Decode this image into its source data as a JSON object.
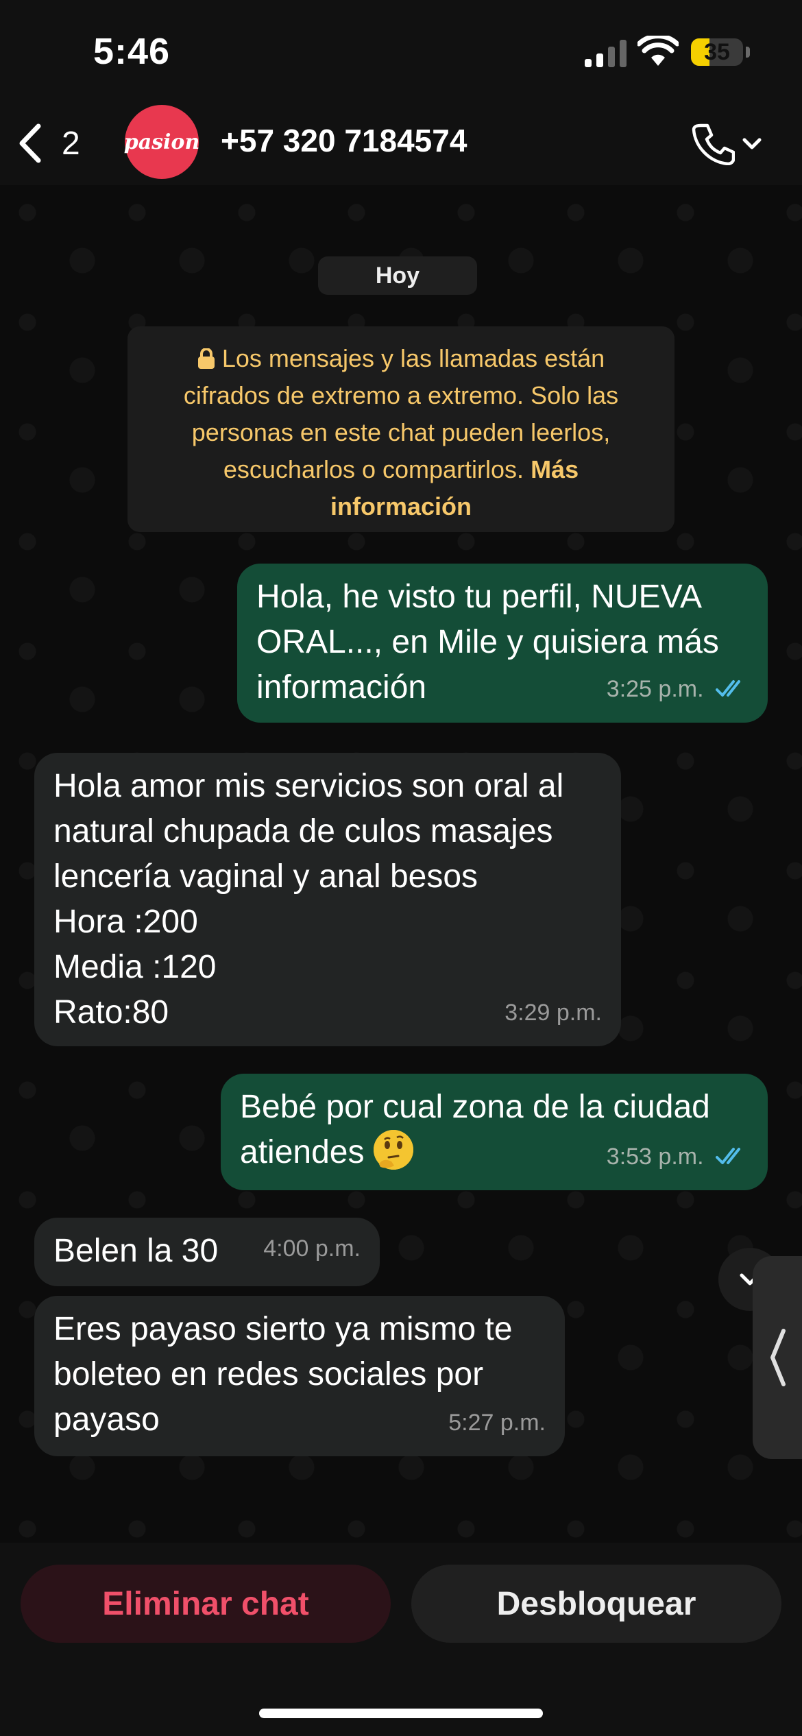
{
  "status": {
    "time": "5:46",
    "battery": "35",
    "battery_level": 0.35,
    "battery_color": "#f5d000"
  },
  "header": {
    "back_count": "2",
    "avatar_text": "pasion",
    "contact": "+57 320 7184574"
  },
  "chat": {
    "date_chip": "Hoy",
    "e2e_line1": "Los mensajes y las llamadas están",
    "e2e_line2": "cifrados de extremo a extremo. Solo las",
    "e2e_line3": "personas en este chat pueden leerlos,",
    "e2e_line4": "escucharlos o compartirlos.",
    "e2e_link1": "Más",
    "e2e_link2": "información",
    "messages": [
      {
        "dir": "out",
        "lines": [
          "Hola, he visto tu perfil, NUEVA",
          "ORAL..., en Mile y quisiera más",
          "información"
        ],
        "time": "3:25 p.m."
      },
      {
        "dir": "in",
        "lines": [
          "Hola amor mis servicios son oral al",
          "natural chupada de culos masajes",
          "lencería vaginal y anal besos",
          "Hora :200",
          "Media :120",
          "Rato:80"
        ],
        "time": "3:29 p.m."
      },
      {
        "dir": "out",
        "lines": [
          "Bebé por cual zona de la ciudad",
          "atiendes"
        ],
        "time": "3:53 p.m."
      },
      {
        "dir": "in",
        "lines": [
          "Belen la 30"
        ],
        "time": "4:00 p.m."
      },
      {
        "dir": "in",
        "lines": [
          "Eres payaso sierto ya mismo te",
          "boleteo en redes sociales por",
          "payaso"
        ],
        "time": "5:27 p.m."
      }
    ]
  },
  "bottom": {
    "delete_label": "Eliminar chat",
    "unblock_label": "Desbloquear"
  },
  "icons": {
    "lock": "lock-icon",
    "ticks": "double-check-icon",
    "call": "phone-icon",
    "back": "chevron-left-icon",
    "scroll": "chevron-down-icon",
    "emoji": "thinking-face-emoji"
  },
  "colors": {
    "outgoing": "#144d37",
    "incoming": "#222424",
    "tick_read": "#53bdeb",
    "encryption_text": "#f7c86a",
    "danger": "#f0506a"
  }
}
